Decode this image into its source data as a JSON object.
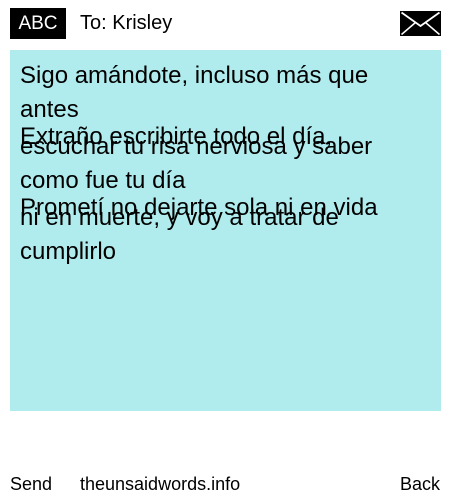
{
  "header": {
    "badge": "ABC",
    "to_label": "To: Krisley",
    "mail_icon": "envelope-icon"
  },
  "message": {
    "lines": [
      "Sigo amándote, incluso más que",
      "antes",
      "Extraño escribirte todo el día,",
      "escuchar tu risa nerviosa y saber",
      "como fue tu día",
      "Prometí no dejarte sola ni en vida",
      "ni en muerte, y voy a tratar de",
      "cumplirlo"
    ],
    "background": "#b0ecee"
  },
  "footer": {
    "send_label": "Send",
    "site_label": "theunsaidwords.info",
    "back_label": "Back"
  }
}
